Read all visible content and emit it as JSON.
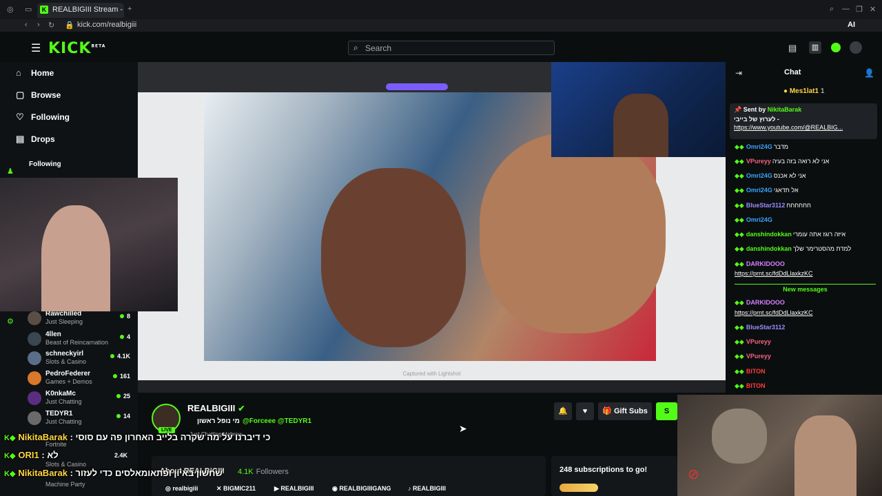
{
  "browser": {
    "tab_title": "REALBIGIII Stream - Wa",
    "url": "kick.com/realbigiii",
    "ai_label": "AI"
  },
  "header": {
    "logo": "KICK",
    "logo_badge": "BETA",
    "search_placeholder": "Search"
  },
  "sidebar": {
    "nav": [
      {
        "label": "Home",
        "icon": "home-icon"
      },
      {
        "label": "Browse",
        "icon": "browse-icon"
      },
      {
        "label": "Following",
        "icon": "heart-icon"
      },
      {
        "label": "Drops",
        "icon": "drops-icon"
      }
    ],
    "following_title": "Following",
    "channels": [
      {
        "name": "Rawchilled",
        "category": "Just Sleeping",
        "viewers": "8",
        "color": "#5b4e45"
      },
      {
        "name": "4llen",
        "category": "Beast of Reincarnation",
        "viewers": "4",
        "color": "#3a4652"
      },
      {
        "name": "schneckyirl",
        "category": "Slots & Casino",
        "viewers": "4.1K",
        "color": "#5a6e8a"
      },
      {
        "name": "PedroFederer",
        "category": "Games + Demos",
        "viewers": "161",
        "color": "#d9772a"
      },
      {
        "name": "K0nkaMc",
        "category": "Just Chatting",
        "viewers": "25",
        "color": "#5b2d82"
      },
      {
        "name": "TEDYR1",
        "category": "Just Chatting",
        "viewers": "14",
        "color": "#6a6a6a"
      }
    ],
    "partial_categories": [
      "Fortnite",
      "Slots & Casino",
      "Machine Party"
    ],
    "partial_viewers": [
      "2.4K"
    ]
  },
  "stream": {
    "screen_caption": "Captured with Lightshot"
  },
  "info": {
    "channel_name": "REALBIGIII",
    "live_badge": "LIVE",
    "title_rtl": "מי נופל ראשון",
    "mentions": "@Forceee @TEDYR1",
    "tags": "Just Chatting  Hebrew",
    "notify_icon": "bell-icon",
    "follow_icon": "heart-icon",
    "gift_subs_label": "Gift Subs",
    "subscribe_label": "S",
    "about_title": "About REALBIGIII",
    "followers_count": "4.1K",
    "followers_label": "Followers",
    "socials": [
      {
        "icon": "instagram-icon",
        "label": "realbigiii"
      },
      {
        "icon": "x-icon",
        "label": "BIGMIC211"
      },
      {
        "icon": "youtube-icon",
        "label": "REALBIGIII"
      },
      {
        "icon": "discord-icon",
        "label": "REALBIGIIIGANG"
      },
      {
        "icon": "tiktok-icon",
        "label": "REALBIGIII"
      }
    ],
    "subscriptions_goal": "248 subscriptions to go!"
  },
  "chat": {
    "title": "Chat",
    "top_gifter": "Mes1lat1",
    "top_gifter_count": "1",
    "pinned": {
      "sent_by_label": "Sent by",
      "sender": "NikitaBarak",
      "text": "לערוץ של בייבי -",
      "link": "https://www.youtube.com/@REALBIG..."
    },
    "messages": [
      {
        "user": "Omri24G",
        "text": "מדבר",
        "color": "#38a4ff"
      },
      {
        "user": "VPureyy",
        "text": "אני לא רואה בזה בעיה",
        "color": "#f5637e"
      },
      {
        "user": "Omri24G",
        "text": "אני לא אכנס",
        "color": "#38a4ff"
      },
      {
        "user": "Omri24G",
        "text": "אל תדאגי",
        "color": "#38a4ff"
      },
      {
        "user": "BlueStar3112",
        "text": "חחחחחח",
        "color": "#9b8cff"
      },
      {
        "user": "Omri24G",
        "text": "",
        "color": "#38a4ff"
      },
      {
        "user": "danshindokkan",
        "text": "איזה רוגז אתה עומרי",
        "color": "#53fc18"
      },
      {
        "user": "danshindokkan",
        "text": "למדת מהסטרימר שלך",
        "color": "#53fc18"
      },
      {
        "user": "DARKIDOOO",
        "text": "",
        "color": "#d780ff"
      }
    ],
    "link_message": "https://prnt.sc/fdDdLlaxkzKC",
    "new_messages_label": "New messages",
    "new_messages": [
      {
        "user": "DARKIDOOO",
        "text": "",
        "color": "#d780ff"
      },
      {
        "user": "BlueStar3112",
        "text": "",
        "color": "#9b8cff"
      },
      {
        "user": "VPureyy",
        "text": "",
        "color": "#f5637e"
      },
      {
        "user": "VPureyy",
        "text": "",
        "color": "#f5637e"
      },
      {
        "user": "BITON",
        "text": "",
        "color": "#ff3b3b"
      },
      {
        "user": "BITON",
        "text": "",
        "color": "#ff3b3b"
      }
    ]
  },
  "overlay_chat": [
    {
      "user": "NikitaBarak",
      "text": ": כי דיברנו על מה שקרה בלייב האחרון פה עם סוסי"
    },
    {
      "user": "ORI1",
      "text": ": לא"
    },
    {
      "user": "NikitaBarak",
      "text": ": שחשון באיון ופתאומאלסים כדי לעזור"
    }
  ]
}
